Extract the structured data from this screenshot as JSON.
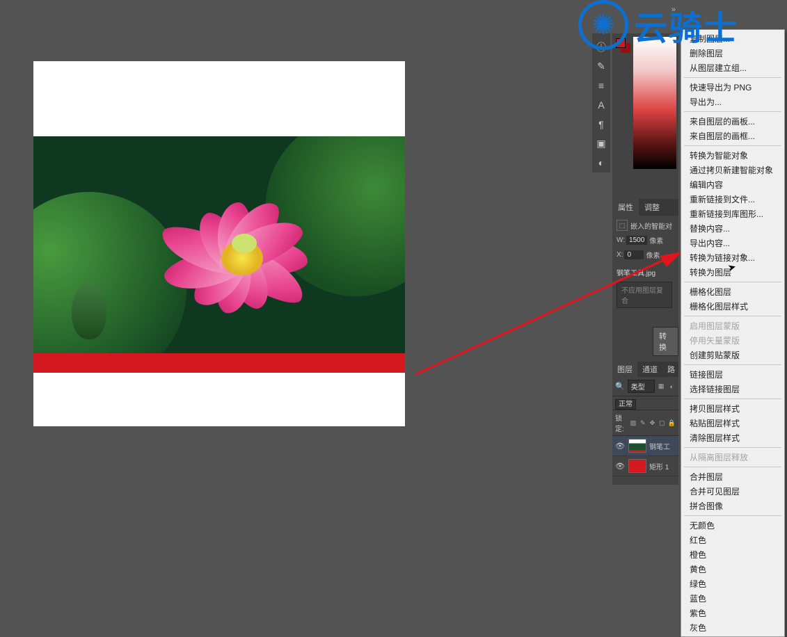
{
  "watermark": {
    "text": "云骑士"
  },
  "toolstrip": {
    "items": [
      {
        "name": "info-icon",
        "glyph": "ⓘ"
      },
      {
        "name": "brush-icon",
        "glyph": "✎"
      },
      {
        "name": "align-icon",
        "glyph": "≡"
      },
      {
        "name": "text-a-icon",
        "glyph": "A"
      },
      {
        "name": "paragraph-icon",
        "glyph": "¶"
      },
      {
        "name": "layers-icon",
        "glyph": "▣"
      },
      {
        "name": "history-icon",
        "glyph": "◐"
      }
    ]
  },
  "properties": {
    "tabs": {
      "props": "属性",
      "adjust": "调整"
    },
    "smartobj_label": "嵌入的智能对",
    "width_label": "W:",
    "width_value": "1500",
    "width_unit": "像素",
    "x_label": "X:",
    "x_value": "0",
    "x_unit": "像素",
    "filename": "钢笔工具.jpg",
    "apply_btn": "不应用图层复合",
    "convert_btn": "转换"
  },
  "layers": {
    "tabs": {
      "layers": "图层",
      "channels": "通道",
      "paths": "路"
    },
    "filter": {
      "kind": "类型"
    },
    "blend_mode": "正常",
    "lock_label": "锁定:",
    "items": [
      {
        "name": "钢笔工",
        "thumb": "photo",
        "selected": true
      },
      {
        "name": "矩形 1",
        "thumb": "rect",
        "selected": false
      }
    ]
  },
  "contextMenu": {
    "groups": [
      [
        {
          "label": "复制图层...",
          "enabled": true
        },
        {
          "label": "删除图层",
          "enabled": true
        },
        {
          "label": "从图层建立组...",
          "enabled": true
        }
      ],
      [
        {
          "label": "快速导出为 PNG",
          "enabled": true
        },
        {
          "label": "导出为...",
          "enabled": true
        }
      ],
      [
        {
          "label": "来自图层的画板...",
          "enabled": true
        },
        {
          "label": "来自图层的画框...",
          "enabled": true
        }
      ],
      [
        {
          "label": "转换为智能对象",
          "enabled": true
        },
        {
          "label": "通过拷贝新建智能对象",
          "enabled": true
        },
        {
          "label": "编辑内容",
          "enabled": true
        },
        {
          "label": "重新链接到文件...",
          "enabled": true
        },
        {
          "label": "重新链接到库图形...",
          "enabled": true
        },
        {
          "label": "替换内容...",
          "enabled": true
        },
        {
          "label": "导出内容...",
          "enabled": true
        },
        {
          "label": "转换为链接对象...",
          "enabled": true
        },
        {
          "label": "转换为图层",
          "enabled": true
        }
      ],
      [
        {
          "label": "栅格化图层",
          "enabled": true
        },
        {
          "label": "栅格化图层样式",
          "enabled": true
        }
      ],
      [
        {
          "label": "启用图层蒙版",
          "enabled": false
        },
        {
          "label": "停用矢量蒙版",
          "enabled": false
        },
        {
          "label": "创建剪贴蒙版",
          "enabled": true
        }
      ],
      [
        {
          "label": "链接图层",
          "enabled": true
        },
        {
          "label": "选择链接图层",
          "enabled": true
        }
      ],
      [
        {
          "label": "拷贝图层样式",
          "enabled": true
        },
        {
          "label": "粘贴图层样式",
          "enabled": true
        },
        {
          "label": "清除图层样式",
          "enabled": true
        }
      ],
      [
        {
          "label": "从隔离图层释放",
          "enabled": false
        }
      ],
      [
        {
          "label": "合并图层",
          "enabled": true
        },
        {
          "label": "合并可见图层",
          "enabled": true
        },
        {
          "label": "拼合图像",
          "enabled": true
        }
      ],
      [
        {
          "label": "无颜色",
          "enabled": true
        },
        {
          "label": "红色",
          "enabled": true
        },
        {
          "label": "橙色",
          "enabled": true
        },
        {
          "label": "黄色",
          "enabled": true
        },
        {
          "label": "绿色",
          "enabled": true
        },
        {
          "label": "蓝色",
          "enabled": true
        },
        {
          "label": "紫色",
          "enabled": true
        },
        {
          "label": "灰色",
          "enabled": true
        }
      ]
    ]
  }
}
